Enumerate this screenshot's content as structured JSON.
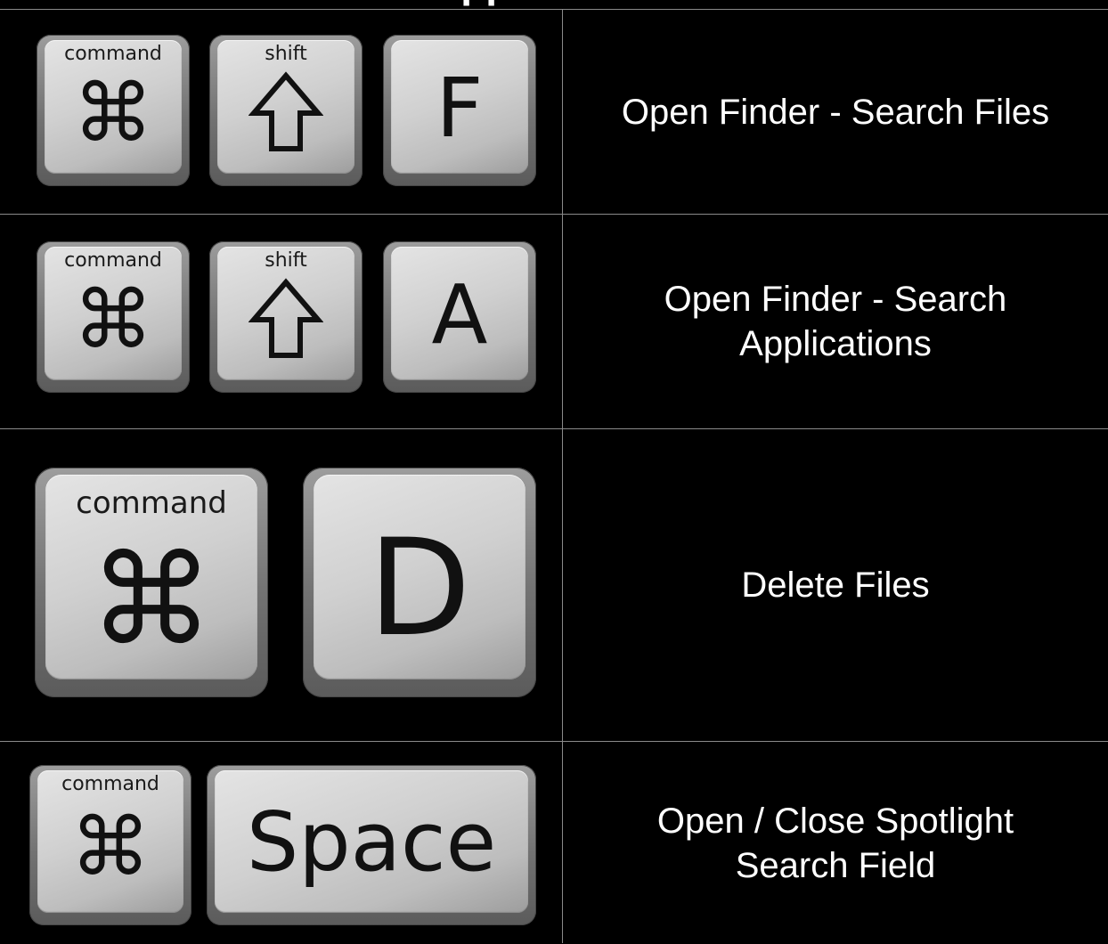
{
  "page_title": "Applications",
  "rows": [
    {
      "keys": [
        {
          "label": "command",
          "symbol": "⌘"
        },
        {
          "label": "shift",
          "symbol": "⇧"
        },
        {
          "letter": "F"
        }
      ],
      "description": "Open Finder - Search Files"
    },
    {
      "keys": [
        {
          "label": "command",
          "symbol": "⌘"
        },
        {
          "label": "shift",
          "symbol": "⇧"
        },
        {
          "letter": "A"
        }
      ],
      "description": "Open Finder - Search Applications"
    },
    {
      "keys": [
        {
          "label": "command",
          "symbol": "⌘"
        },
        {
          "letter": "D"
        }
      ],
      "description": "Delete Files"
    },
    {
      "keys": [
        {
          "label": "command",
          "symbol": "⌘"
        },
        {
          "letter": "Space"
        }
      ],
      "description": "Open / Close Spotlight Search Field"
    }
  ],
  "colors": {
    "background": "#000000",
    "grid_line": "#8a8a8a",
    "key_face": "#d0d0d0",
    "text": "#ffffff"
  }
}
